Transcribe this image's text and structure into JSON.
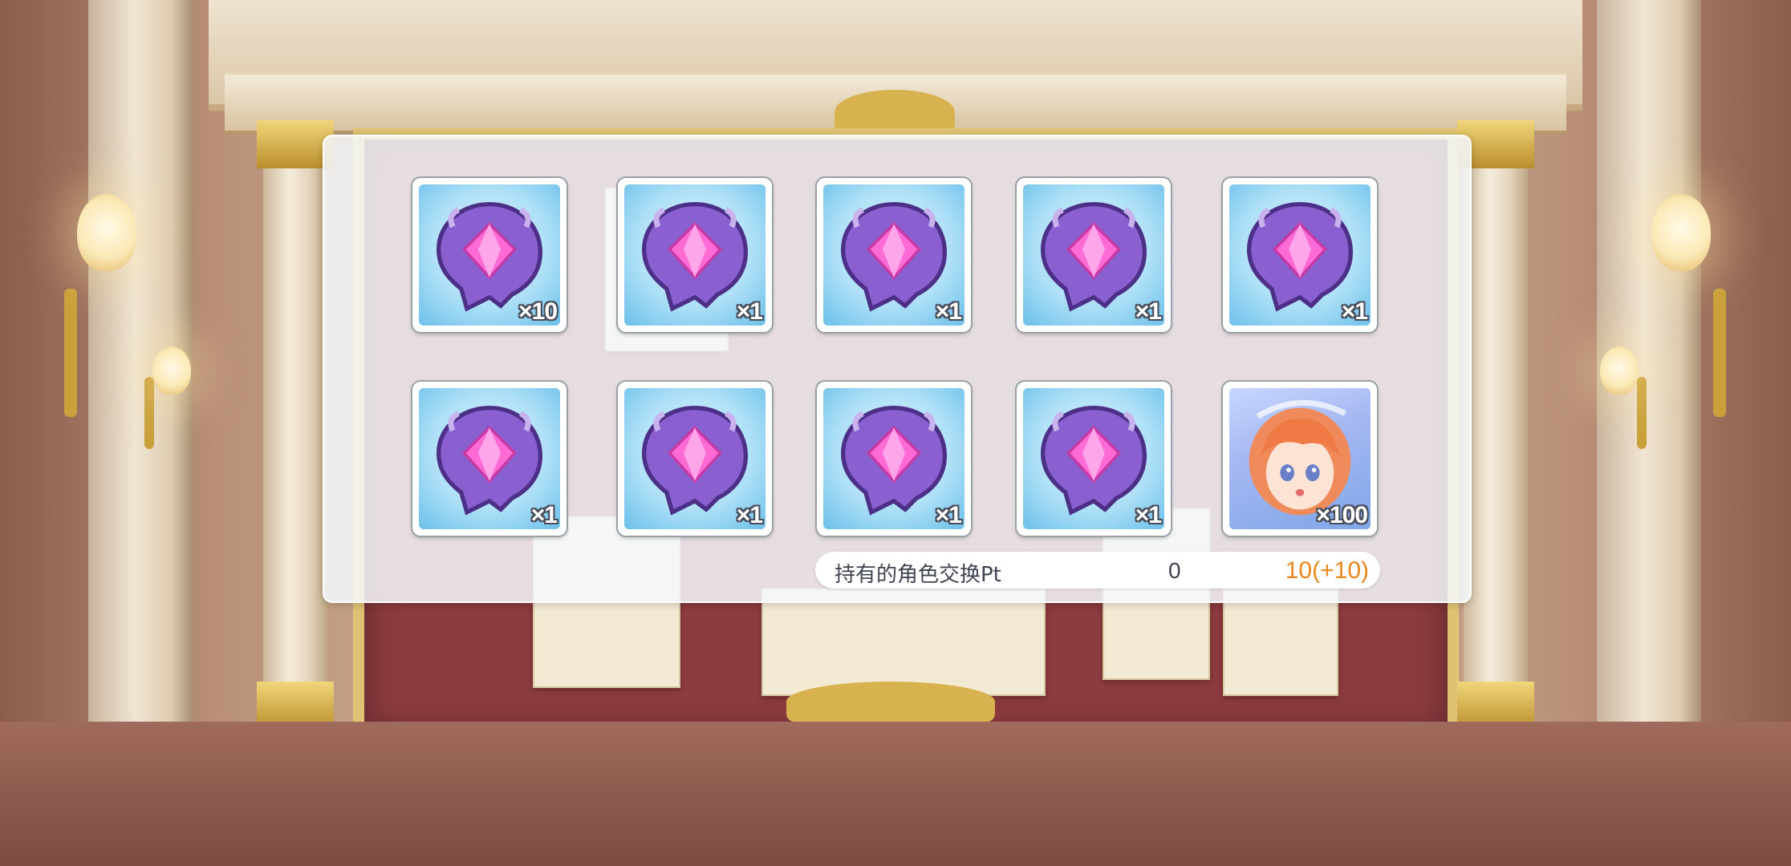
{
  "rewards": {
    "items": [
      {
        "icon": "memory-piece-icon",
        "quantity": "×10"
      },
      {
        "icon": "memory-piece-icon",
        "quantity": "×1"
      },
      {
        "icon": "memory-piece-icon",
        "quantity": "×1"
      },
      {
        "icon": "memory-piece-icon",
        "quantity": "×1"
      },
      {
        "icon": "memory-piece-icon",
        "quantity": "×1"
      },
      {
        "icon": "memory-piece-icon",
        "quantity": "×1"
      },
      {
        "icon": "memory-piece-icon",
        "quantity": "×1"
      },
      {
        "icon": "memory-piece-icon",
        "quantity": "×1"
      },
      {
        "icon": "memory-piece-icon",
        "quantity": "×1"
      },
      {
        "icon": "character-portrait-icon",
        "quantity": "×100"
      }
    ]
  },
  "exchange_pt": {
    "label": "持有的角色交换Pt",
    "owned": "0",
    "after": "10(+10)"
  },
  "colors": {
    "accent_orange": "#e8871a",
    "panel_bg": "#f5f8fc",
    "item_bg": "#aee0f7",
    "gem_purple": "#8a5fd0"
  }
}
